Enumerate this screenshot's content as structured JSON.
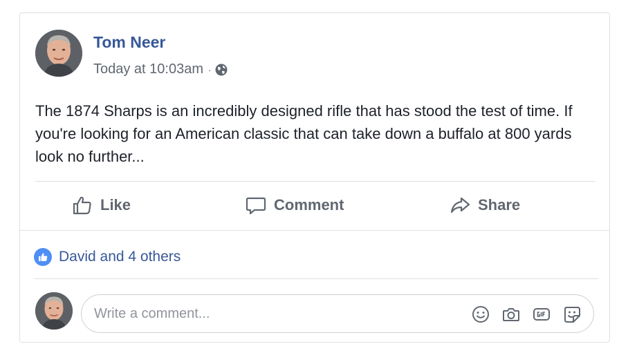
{
  "post": {
    "author_name": "Tom Neer",
    "timestamp": "Today at 10:03am",
    "separator": "·",
    "privacy_icon": "globe-icon",
    "text": "The 1874 Sharps is an incredibly designed rifle that has stood the test of time. If you're looking for an American classic that can take down a buffalo at 800 yards look no further..."
  },
  "actions": {
    "like_label": "Like",
    "comment_label": "Comment",
    "share_label": "Share"
  },
  "reactions": {
    "text": "David and 4 others",
    "icon": "thumbs-up-icon"
  },
  "comment": {
    "placeholder": "Write a comment...",
    "tools": [
      "smiley-icon",
      "camera-icon",
      "gif-icon",
      "sticker-icon"
    ]
  },
  "colors": {
    "link_blue": "#385898",
    "like_badge": "#4f8ef5",
    "muted_text": "#606770",
    "border": "#dddfe2"
  }
}
